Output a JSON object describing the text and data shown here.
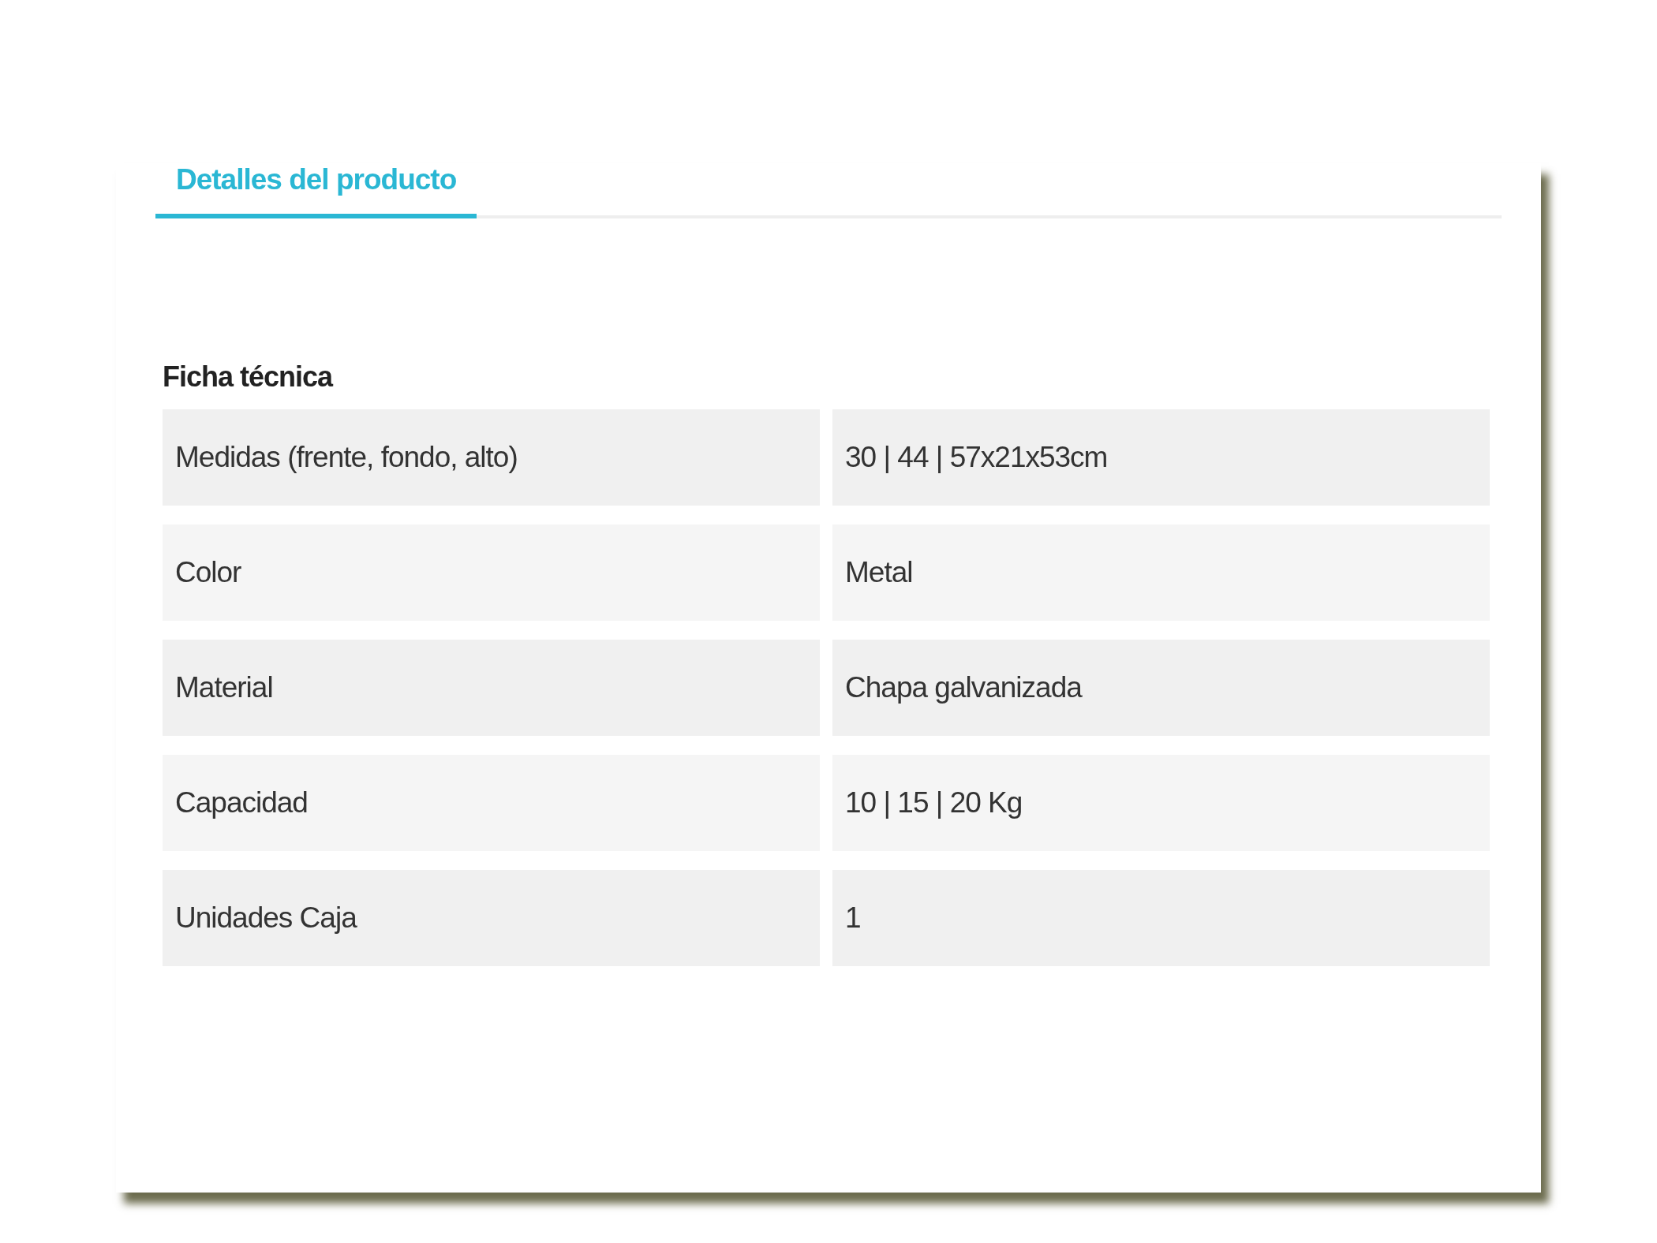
{
  "tabs": [
    {
      "label": "Detalles del producto",
      "selected": true
    }
  ],
  "section_title": "Ficha técnica",
  "rows": [
    {
      "label": "Medidas (frente, fondo, alto)",
      "value": "30 | 44 | 57x21x53cm"
    },
    {
      "label": "Color",
      "value": "Metal"
    },
    {
      "label": "Material",
      "value": "Chapa galvanizada"
    },
    {
      "label": "Capacidad",
      "value": "10 | 15 | 20 Kg"
    },
    {
      "label": "Unidades Caja",
      "value": "1"
    }
  ]
}
